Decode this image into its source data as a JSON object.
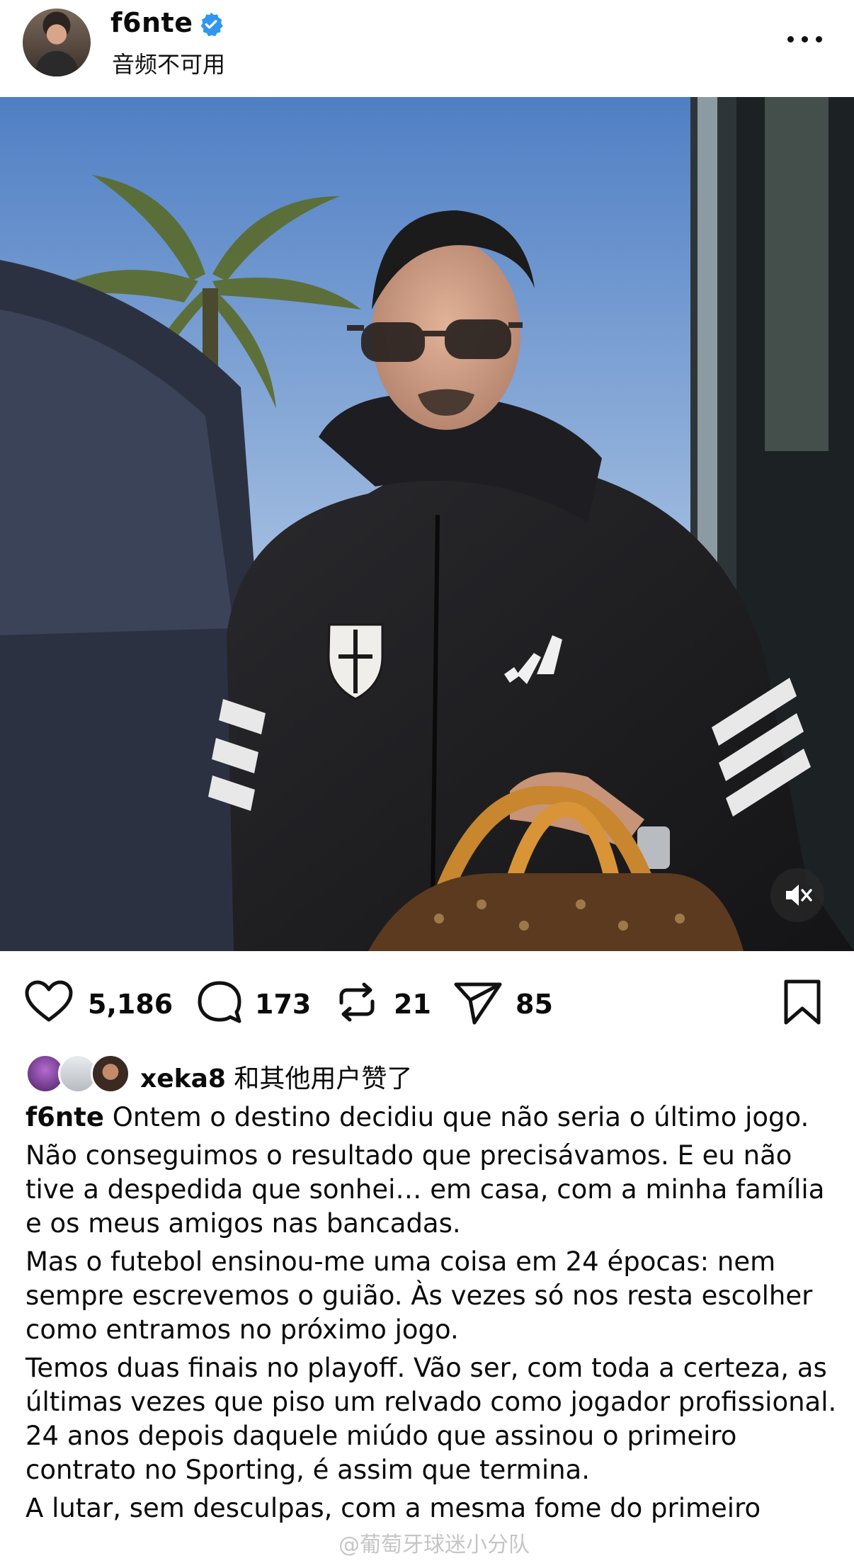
{
  "header": {
    "username": "f6nte",
    "subtitle": "音频不可用",
    "verified_icon": "verified-badge-icon",
    "more_icon": "more-horizontal-icon"
  },
  "photo": {
    "description_icon": "post-photo",
    "mute_icon": "speaker-muted-icon"
  },
  "actions": {
    "likes": "5,186",
    "comments": "173",
    "reposts": "21",
    "shares": "85"
  },
  "liked_by": {
    "user": "xeka8",
    "suffix": " 和其他用户赞了"
  },
  "caption": {
    "username": "f6nte",
    "paragraphs": [
      "Ontem o destino decidiu que não seria o último jogo.",
      "Não conseguimos o resultado que precisávamos. E eu não tive a despedida que sonhei… em casa, com a minha família e os meus amigos nas bancadas.",
      "Mas o futebol ensinou-me uma coisa em 24 épocas: nem sempre escrevemos o guião. Às vezes só nos resta escolher como entramos no próximo jogo.",
      "Temos duas finais no playoff. Vão ser, com toda a certeza, as últimas vezes que piso um relvado como jogador profissional. 24 anos depois daquele miúdo que assinou o primeiro contrato no Sporting, é assim que termina.",
      "A lutar, sem desculpas, com a mesma fome do primeiro"
    ]
  },
  "watermark": "@葡萄牙球迷小分队",
  "colors": {
    "verified": "#2f97f0",
    "text": "#0b0b0b"
  }
}
